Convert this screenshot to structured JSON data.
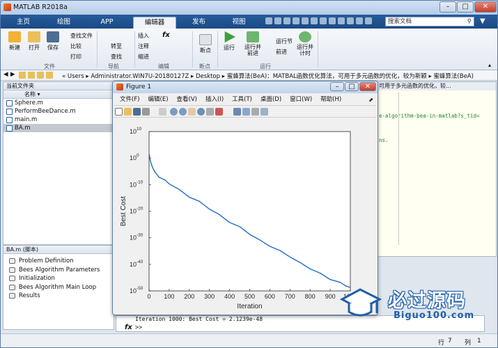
{
  "app": {
    "title": "MATLAB R2018a"
  },
  "tabs": [
    "主页",
    "绘图",
    "APP",
    "编辑器",
    "发布",
    "视图"
  ],
  "search": {
    "placeholder": "搜索文档"
  },
  "ribbon": {
    "file": {
      "new": "新建",
      "open": "打开",
      "save": "保存",
      "find_files": "查找文件",
      "compare": "比较",
      "print": "打印",
      "group": "文件"
    },
    "navigate": {
      "goto": "转至",
      "find": "查找",
      "group": "导航"
    },
    "edit": {
      "insert": "插入",
      "comment": "注释",
      "indent": "缩进",
      "fx": "fx",
      "group": "编辑"
    },
    "breakpoints": {
      "label": "断点",
      "group": "断点"
    },
    "run": {
      "run": "运行",
      "run_advance": "运行并\n前进",
      "run_section": "运行节",
      "advance": "前进",
      "run_time": "运行并\n计时",
      "group": "运行"
    }
  },
  "address": {
    "path": "«  Users  ▸  Administrator.WIN7U-20180127Z  ▸  Desktop  ▸  蜜蜂算法(BeA)：MATBAL函数优化算法，可用于多元函数的优化，较为新颖  ▸  蜜蜂算法(BeA)"
  },
  "current_folder": {
    "title": "当前文件夹",
    "column": "名称 ▾",
    "files": [
      "Sphere.m",
      "PerformBeeDance.m",
      "main.m",
      "BA.m"
    ],
    "selected": "BA.m"
  },
  "details": {
    "title": "BA.m  (脚本)",
    "items": [
      "Problem Definition",
      "Bees Algorithm Parameters",
      "Initialization",
      "Bees Algorithm Main Loop",
      "Results"
    ]
  },
  "editor": {
    "line1": "可用于多元函数的优化，较...",
    "line2": "e-algorithm-bea-in-matlab?s_tid=",
    "line3": "ns."
  },
  "command": {
    "output": "Iteration 1000: Best Cost = 2.1239e-48",
    "prompt": ">>",
    "fx": "fx"
  },
  "status": {
    "col": "行",
    "col_val": "7",
    "row": "列",
    "row_val": "1"
  },
  "figure": {
    "title": "Figure 1",
    "menu": [
      "文件(F)",
      "编辑(E)",
      "查看(V)",
      "插入(I)",
      "工具(T)",
      "桌面(D)",
      "窗口(W)",
      "帮助(H)"
    ]
  },
  "chart_data": {
    "type": "line",
    "xlabel": "Iteration",
    "ylabel": "Best Cost",
    "xlim": [
      0,
      1000
    ],
    "ylim_log10": [
      -50,
      10
    ],
    "yscale": "log",
    "xticks": [
      0,
      100,
      200,
      300,
      400,
      500,
      600,
      700,
      800,
      900,
      1000
    ],
    "yticks_exp": [
      10,
      0,
      -10,
      -20,
      -30,
      -40,
      -50
    ],
    "series": [
      {
        "color": "#1f6fc0",
        "x": [
          1,
          5,
          10,
          20,
          30,
          50,
          80,
          100,
          150,
          200,
          250,
          300,
          350,
          400,
          450,
          500,
          550,
          600,
          650,
          700,
          750,
          800,
          850,
          900,
          950,
          980,
          1000
        ],
        "log10y": [
          1.5,
          -0.5,
          -2,
          -4,
          -5.5,
          -7,
          -8.5,
          -9.5,
          -12,
          -14.5,
          -16.5,
          -19,
          -21.5,
          -24,
          -26,
          -28.5,
          -31,
          -33,
          -35,
          -37,
          -39.5,
          -41.5,
          -43.5,
          -45.5,
          -47,
          -48,
          -48.7
        ]
      }
    ]
  },
  "watermark": {
    "text": "必过源码",
    "sub": "Biguo100.com"
  }
}
